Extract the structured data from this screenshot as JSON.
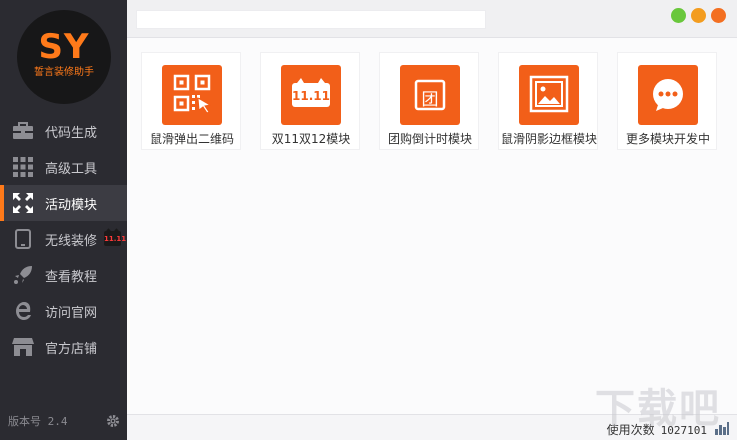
{
  "app": {
    "logo_text": "SY",
    "logo_subtitle": "誓言装修助手"
  },
  "sidebar": {
    "items": [
      {
        "label": "代码生成",
        "icon": "briefcase-icon"
      },
      {
        "label": "高级工具",
        "icon": "grid-icon"
      },
      {
        "label": "活动模块",
        "icon": "expand-icon",
        "active": true
      },
      {
        "label": "无线装修",
        "icon": "tablet-icon",
        "badge": "11.11"
      },
      {
        "label": "查看教程",
        "icon": "rocket-icon"
      },
      {
        "label": "访问官网",
        "icon": "ie-icon"
      },
      {
        "label": "官方店铺",
        "icon": "store-icon"
      }
    ],
    "version": "版本号 2.4"
  },
  "topbar": {
    "search_value": "",
    "window_buttons": [
      {
        "name": "minimize",
        "color": "#69c73c"
      },
      {
        "name": "maximize",
        "color": "#f39c1f"
      },
      {
        "name": "close",
        "color": "#f36f21"
      }
    ]
  },
  "modules": [
    {
      "label": "鼠滑弹出二维码",
      "icon": "qrcode-icon"
    },
    {
      "label": "双11双12模块",
      "icon": "tmall-1111-icon",
      "icon_text": "11.11"
    },
    {
      "label": "团购倒计时模块",
      "icon": "group-buy-icon",
      "icon_text": "团"
    },
    {
      "label": "鼠滑阴影边框模块",
      "icon": "picture-frame-icon"
    },
    {
      "label": "更多模块开发中",
      "icon": "more-dots-icon"
    }
  ],
  "status": {
    "usage_label": "使用次数",
    "usage_count": "1027101"
  },
  "watermark": "下载吧",
  "colors": {
    "accent": "#f25f19",
    "sidebar_bg": "#2b2b31",
    "logo_orange": "#ff7a1a"
  }
}
